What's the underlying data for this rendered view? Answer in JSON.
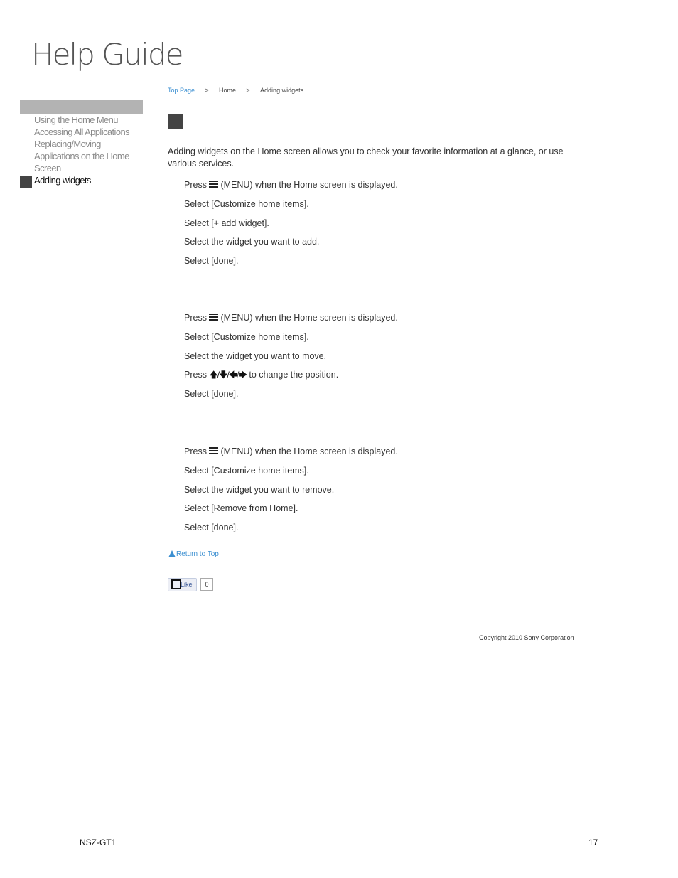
{
  "header": {
    "title": "Help Guide"
  },
  "breadcrumb": {
    "top_page": "Top Page",
    "sep": ">",
    "home": "Home",
    "current": "Adding widgets"
  },
  "sidebar": {
    "items": [
      {
        "label": "Using the Home Menu"
      },
      {
        "label": "Accessing All Applications"
      },
      {
        "label": "Replacing/Moving"
      },
      {
        "label": "Applications on the Home"
      },
      {
        "label": "Screen"
      },
      {
        "label": "Adding widgets"
      }
    ]
  },
  "content": {
    "intro": "Adding widgets on the Home screen allows you to check your favorite information at a glance, or use various services.",
    "press": "Press",
    "menu_suffix": "(MENU) when the Home screen is displayed.",
    "arrows": "🡅/🡇/🡄/🡆",
    "position_suffix": "to change the position.",
    "add_steps": [
      "Select [Customize home items].",
      "Select [+ add widget].",
      "Select the widget you want to add.",
      "Select [done]."
    ],
    "move_steps": [
      "Select [Customize home items].",
      "Select the widget you want to move."
    ],
    "move_final": "Select [done].",
    "remove_steps": [
      "Select [Customize home items].",
      "Select the widget you want to remove.",
      "Select [Remove from Home].",
      "Select [done]."
    ]
  },
  "return_to_top": "Return to Top",
  "like": {
    "label": "Like",
    "count": "0"
  },
  "copyright": "Copyright 2010 Sony Corporation",
  "footer": {
    "model": "NSZ-GT1",
    "page": "17"
  },
  "colors": {
    "link": "#3b8fd1",
    "marker": "#444444",
    "sidebar_bar": "#b3b3b3"
  },
  "icons": [
    "menu-icon",
    "arrow-icons",
    "triangle-up-icon"
  ]
}
